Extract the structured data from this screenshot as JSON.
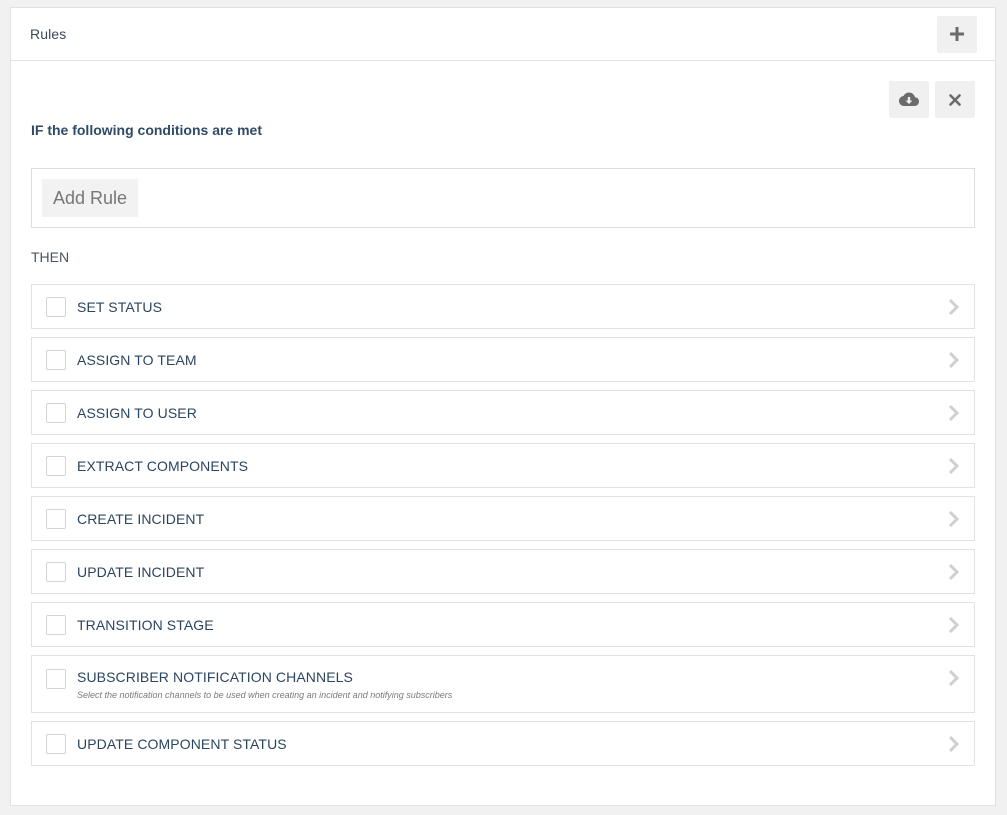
{
  "header": {
    "title": "Rules",
    "add_icon": "plus-icon"
  },
  "editor": {
    "save_icon": "cloud-download-icon",
    "close_icon": "close-icon",
    "conditions_label": "IF the following conditions are met",
    "add_rule_label": "Add Rule",
    "then_label": "THEN"
  },
  "actions": [
    {
      "label": "SET STATUS",
      "description": ""
    },
    {
      "label": "ASSIGN TO TEAM",
      "description": ""
    },
    {
      "label": "ASSIGN TO USER",
      "description": ""
    },
    {
      "label": "EXTRACT COMPONENTS",
      "description": ""
    },
    {
      "label": "CREATE INCIDENT",
      "description": ""
    },
    {
      "label": "UPDATE INCIDENT",
      "description": ""
    },
    {
      "label": "TRANSITION STAGE",
      "description": ""
    },
    {
      "label": "SUBSCRIBER NOTIFICATION CHANNELS",
      "description": "Select the notification channels to be used when creating an incident and notifying subscribers"
    },
    {
      "label": "UPDATE COMPONENT STATUS",
      "description": ""
    }
  ],
  "colors": {
    "heading": "#2f4a66",
    "icon": "#6b6b6b",
    "chevron": "#cfcfcf"
  }
}
